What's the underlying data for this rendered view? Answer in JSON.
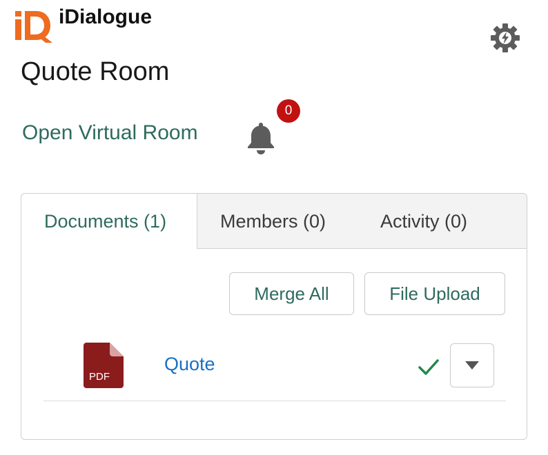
{
  "app": {
    "brand_name": "iDialogue",
    "title": "Quote Room"
  },
  "header": {
    "open_room_label": "Open Virtual Room",
    "notification_count": "0"
  },
  "tabs": [
    {
      "label": "Documents (1)",
      "active": true
    },
    {
      "label": "Members (0)",
      "active": false
    },
    {
      "label": "Activity (0)",
      "active": false
    }
  ],
  "toolbar": {
    "merge_label": "Merge All",
    "upload_label": "File Upload"
  },
  "documents": [
    {
      "file_type": "PDF",
      "name": "Quote",
      "status_icon": "check-icon"
    }
  ],
  "colors": {
    "brand_orange": "#ee6b1f",
    "accent_green": "#2e6b5e",
    "link_blue": "#1a6fc4",
    "badge_red": "#c11111",
    "pdf_red": "#8b1c1c",
    "check_green": "#1f8a4c"
  },
  "icons": {
    "logo": "idialogue-logo",
    "settings": "gear-lightning-icon",
    "notifications": "bell-icon",
    "file": "pdf-file-icon",
    "menu": "caret-down-icon"
  }
}
